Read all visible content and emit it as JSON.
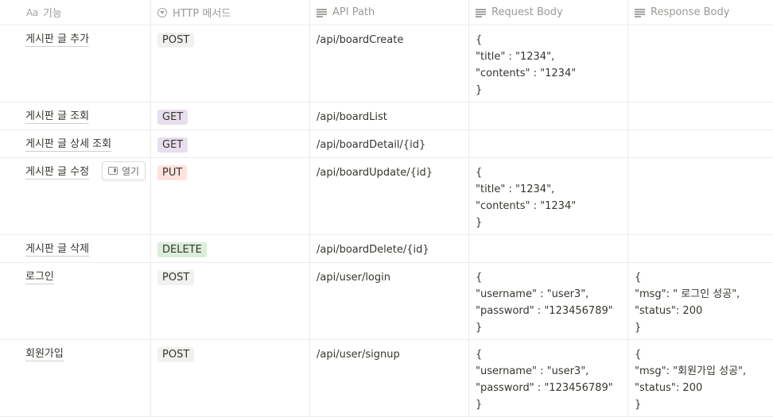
{
  "headers": {
    "name": {
      "icon": "Aa",
      "label": "기능"
    },
    "method": {
      "label": "HTTP 메서드"
    },
    "path": {
      "label": "API Path"
    },
    "request": {
      "label": "Request Body"
    },
    "response": {
      "label": "Response Body"
    }
  },
  "rows": [
    {
      "name": "게시판 글 추가",
      "method": "POST",
      "path": "/api/boardCreate",
      "request": "{\n\"title\" : \"1234\",\n\"contents\" : \"1234\"\n}",
      "response": ""
    },
    {
      "name": "게시판 글 조회",
      "method": "GET",
      "path": "/api/boardList",
      "request": "",
      "response": ""
    },
    {
      "name": "게시판 글 상세 조회",
      "method": "GET",
      "path": "/api/boardDetail/{id}",
      "request": "",
      "response": ""
    },
    {
      "name": "게시판 글 수정",
      "method": "PUT",
      "path": "/api/boardUpdate/{id}",
      "request": "{\n\"title\" : \"1234\",\n\"contents\" : \"1234\"\n}",
      "response": ""
    },
    {
      "name": "게시판 글 삭제",
      "method": "DELETE",
      "path": "/api/boardDelete/{id}",
      "request": "",
      "response": ""
    },
    {
      "name": "로그인",
      "method": "POST",
      "path": "/api/user/login",
      "request": "{\n\"username\" : \"user3\",\n\"password\" : \"123456789\"\n}",
      "response": "{\n\"msg\": \" 로그인 성공\",\n\"status\": 200\n}"
    },
    {
      "name": "회원가입",
      "method": "POST",
      "path": "/api/user/signup",
      "request": "{\n\"username\" : \"user3\",\n\"password\" : \"123456789\"\n}",
      "response": "{\n\"msg\": \"회원가입 성공\",\n\"status\": 200\n}"
    }
  ],
  "hover_button": {
    "label": "열기"
  },
  "colors": {
    "post": "#f1f1ef",
    "get": "#e8deee",
    "put": "#ffe2dd",
    "delete": "#dbeddb"
  }
}
